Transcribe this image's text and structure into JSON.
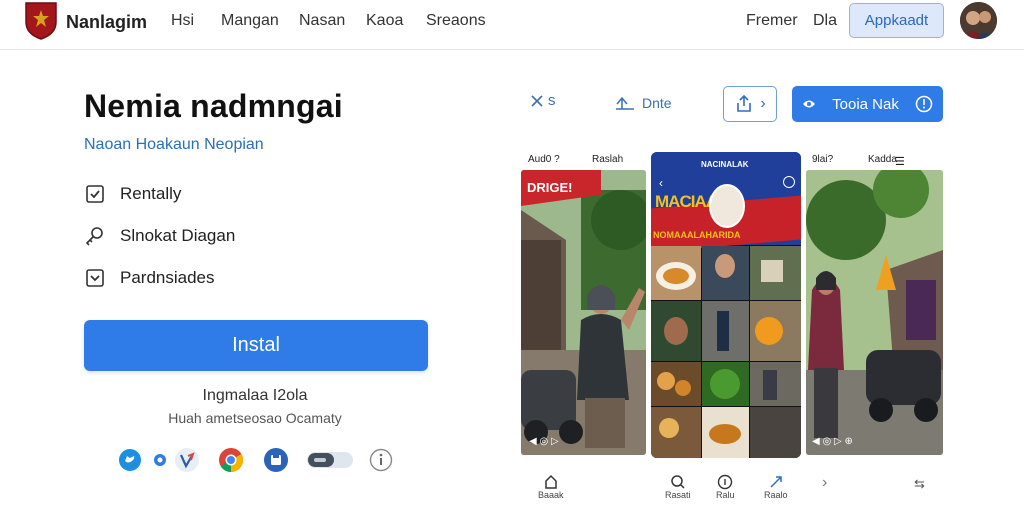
{
  "nav": {
    "brand": "Nanlagim",
    "links": [
      "Hsi",
      "Mangan",
      "Nasan",
      "Kaoa",
      "Sreaons"
    ],
    "right_links": [
      "Fremer",
      "Dla"
    ],
    "app_button": "Appkaadt"
  },
  "hero": {
    "title": "Nemia nadmngai",
    "subtitle": "Naoan Hoakaun Neopian",
    "features": [
      {
        "label": "Rentally",
        "icon": "check-square-icon"
      },
      {
        "label": "Slnokat Diagan",
        "icon": "key-icon"
      },
      {
        "label": "Pardnsiades",
        "icon": "chevron-square-icon"
      }
    ],
    "install_label": "Instal",
    "info_line1": "Ingmalaa I2ola",
    "info_line2": "Huah ametseosao Ocamaty"
  },
  "platforms": [
    "twitter-icon",
    "video-icon",
    "vimeo-icon",
    "chrome-icon",
    "save-icon",
    "toggle-icon",
    "info-icon"
  ],
  "toolbar": {
    "close_label": "s",
    "done_label": "Dnte",
    "share_suffix": "›",
    "primary_label": "Tooia Nak"
  },
  "panels": {
    "left_caption_left": "Aud0 ?",
    "left_caption_right": "Raslah",
    "left_banner": "DRIGE!",
    "center_header_small": "NACINALAK",
    "center_banner": "MACIAA",
    "center_banner_line2": "NOMAAALAHARIDA",
    "right_caption_left": "9lai?",
    "right_caption_right": "Kadda"
  },
  "bottom_nav": [
    {
      "label": "Baaak",
      "icon": "home-icon"
    },
    {
      "label": "Rasati",
      "icon": "search-icon"
    },
    {
      "label": "Ralu",
      "icon": "info-icon"
    },
    {
      "label": "Raalo",
      "icon": "share-icon"
    }
  ],
  "colors": {
    "accent": "#2f7be8",
    "link": "#2c6fb5",
    "app_button_bg": "#dde9fb",
    "logo_red": "#a3161c"
  }
}
